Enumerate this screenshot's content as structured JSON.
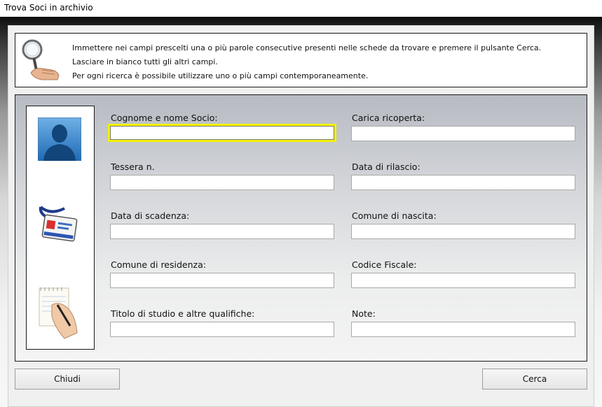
{
  "window": {
    "title": "Trova Soci in archivio"
  },
  "info": {
    "icon": "magnifier-hand-icon",
    "lines": [
      "Immettere nei campi prescelti una o più parole consecutive presenti nelle schede da trovare e premere il pulsante Cerca.",
      "Lasciare in bianco tutti gli altri campi.",
      "Per ogni ricerca è possibile utilizzare uno o più campi contemporaneamente."
    ]
  },
  "icons": [
    "person-silhouette-icon",
    "id-badge-icon",
    "notepad-writing-icon"
  ],
  "fields": {
    "cognome_nome": {
      "label": "Cognome e nome Socio:",
      "value": ""
    },
    "carica": {
      "label": "Carica ricoperta:",
      "value": ""
    },
    "tessera": {
      "label": "Tessera n.",
      "value": ""
    },
    "data_rilascio": {
      "label": "Data di rilascio:",
      "value": ""
    },
    "data_scadenza": {
      "label": "Data di scadenza:",
      "value": ""
    },
    "comune_nascita": {
      "label": "Comune di nascita:",
      "value": ""
    },
    "comune_residenza": {
      "label": "Comune di residenza:",
      "value": ""
    },
    "codice_fiscale": {
      "label": "Codice Fiscale:",
      "value": ""
    },
    "titolo_studio": {
      "label": "Titolo di studio e altre qualifiche:",
      "value": ""
    },
    "note": {
      "label": "Note:",
      "value": ""
    }
  },
  "buttons": {
    "close": "Chiudi",
    "search": "Cerca"
  },
  "colors": {
    "focus_border": "#f2f200",
    "panel_border": "#1a1a1a"
  }
}
